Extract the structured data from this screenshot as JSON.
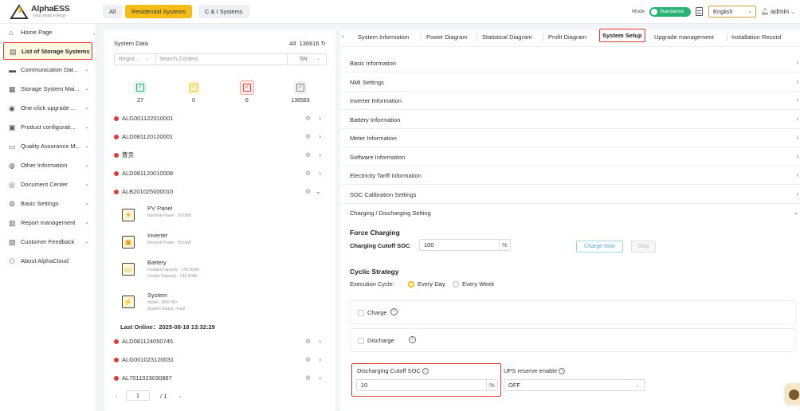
{
  "brand": {
    "name": "AlphaESS",
    "tagline": "your smart energy",
    "icon": "alphaess-logo-icon"
  },
  "categories": [
    {
      "label": "All",
      "active": false
    },
    {
      "label": "Residential Systems",
      "active": true
    },
    {
      "label": "C & I Systems",
      "active": false
    }
  ],
  "header": {
    "mode_label": "Mode",
    "mode_value": "Standalone",
    "language": "English",
    "user": "admin"
  },
  "sidebar": {
    "items": [
      {
        "label": "Home Page",
        "icon": "home-icon",
        "chev": ""
      },
      {
        "label": "List of Storage Systems",
        "icon": "list-icon",
        "chev": ""
      },
      {
        "label": "Communication Dat...",
        "icon": "communication-icon",
        "chev": "⌄"
      },
      {
        "label": "Storage System Mai...",
        "icon": "maintenance-icon",
        "chev": "⌄"
      },
      {
        "label": "One-click upgrade ...",
        "icon": "upgrade-icon",
        "chev": "⌄"
      },
      {
        "label": "Product configurati...",
        "icon": "product-config-icon",
        "chev": "⌄"
      },
      {
        "label": "Quality Assurance M...",
        "icon": "quality-icon",
        "chev": "⌄"
      },
      {
        "label": "Other Information",
        "icon": "info-icon",
        "chev": "⌄"
      },
      {
        "label": "Document Center",
        "icon": "document-icon",
        "chev": "⌄"
      },
      {
        "label": "Basic Settings",
        "icon": "settings-icon",
        "chev": "⌄"
      },
      {
        "label": "Report management",
        "icon": "report-icon",
        "chev": "⌄"
      },
      {
        "label": "Customer Feedback",
        "icon": "feedback-icon",
        "chev": "⌄"
      },
      {
        "label": "About AlphaCloud",
        "icon": "about-icon",
        "chev": ""
      }
    ]
  },
  "system_panel": {
    "title": "System Data",
    "count_label": "All",
    "count_value": "136616",
    "filter_select": "Regist...",
    "search_placeholder": "Search Content",
    "search_by": "SN",
    "stats": [
      {
        "value": "27",
        "color": "#27b277",
        "bg": "#e6f6ee",
        "icon": "normal-status-icon"
      },
      {
        "value": "0",
        "color": "#f6bd16",
        "bg": "#fff6d5",
        "icon": "warning-status-icon"
      },
      {
        "value": "6",
        "color": "#e53935",
        "bg": "#fdecea",
        "icon": "fault-status-icon"
      },
      {
        "value": "136583",
        "color": "#888888",
        "bg": "#f0f0f0",
        "icon": "offline-status-icon"
      }
    ],
    "systems_top": [
      "ALG001122010001",
      "ALD081120120001",
      "曹贡",
      "ALD081120010008",
      "ALB201025000010"
    ],
    "components": [
      {
        "title": "PV Panel",
        "lines": [
          "Nominal Power : 50.0kW"
        ],
        "icon": "pv-panel-icon"
      },
      {
        "title": "Inverter",
        "lines": [
          "Nominal Power : 50.0kW"
        ],
        "icon": "inverter-icon"
      },
      {
        "title": "Battery",
        "lines": [
          "Installed capacity : 143.2kWh",
          "Usable Capacity : 143.2kWh"
        ],
        "icon": "battery-icon"
      },
      {
        "title": "System",
        "lines": [
          "Model : M50-INV",
          "System Status : Fault"
        ],
        "icon": "system-icon"
      }
    ],
    "last_online": "Last Online：2025-08-18 13:32:29",
    "systems_bottom": [
      "ALD081124050745",
      "ALG001023120031",
      "AL7011023030887"
    ],
    "pager": {
      "current": "1",
      "total": "/ 1"
    }
  },
  "tabs": [
    "System Information",
    "Power Diagram",
    "Statistical Diagram",
    "Profit Diagram",
    "System Setup",
    "Upgrade management",
    "Installation Record"
  ],
  "active_tab": "System Setup",
  "accordion": [
    "Basic Information",
    "NMI Settings",
    "Inverter Information",
    "Battery Information",
    "Meter Information",
    "Software Information",
    "Electricity Tariff Information",
    "SOC Calibration Settings",
    "Charging / Discharging Setting"
  ],
  "force_charging": {
    "title": "Force Charging",
    "cutoff_label": "Charging Cutoff SOC",
    "cutoff_value": "100",
    "unit": "%",
    "charge_now": "Charge Now",
    "stop": "Stop"
  },
  "cyclic": {
    "title": "Cyclic Strategy",
    "exec_label": "Execution Cycle:",
    "every_day": "Every Day",
    "every_week": "Every Week",
    "charge": "Charge",
    "discharge": "Discharge"
  },
  "discharge_cutoff": {
    "label": "Discharging Cutoff SOC",
    "value": "10",
    "unit": "%"
  },
  "ups": {
    "label": "UPS reserve enable",
    "value": "OFF"
  }
}
